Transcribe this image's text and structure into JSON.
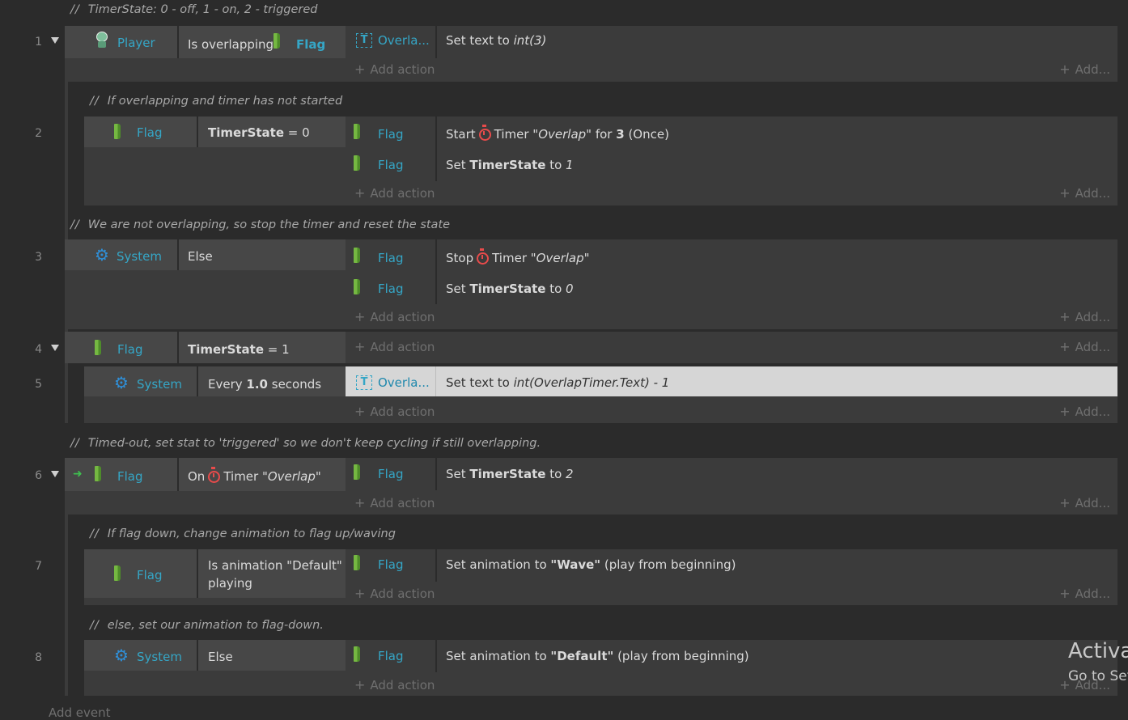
{
  "comments": {
    "c0": "TimerState: 0 - off, 1 - on, 2 - triggered",
    "c2": "If overlapping and timer has not started",
    "c3": "We are not overlapping, so stop the timer and reset the state",
    "c6": "Timed-out, set stat to 'triggered' so we don't keep cycling if still overlapping.",
    "c7": "If flag down, change animation to flag up/waving",
    "c8": "else, set our animation to flag-down."
  },
  "comment_marker": "//",
  "line_numbers": [
    "1",
    "2",
    "3",
    "4",
    "5",
    "6",
    "7",
    "8"
  ],
  "add_action": "Add action",
  "add_right": "Add...",
  "events": {
    "e1": {
      "obj": "Player",
      "cond_text": "Is overlapping",
      "cond_obj": "Flag",
      "a1_obj": "Overla...",
      "a1_text": "Set text to ",
      "a1_italic": "int(3)"
    },
    "e2": {
      "obj": "Flag",
      "cond_var": "TimerState",
      "cond_rest": " = 0",
      "a1_obj": "Flag",
      "a1_pre": "Start",
      "a1_mid": "Timer \"",
      "a1_name": "Overlap",
      "a1_post": "\" for ",
      "a1_num": "3",
      "a1_tail": " (Once)",
      "a2_obj": "Flag",
      "a2_pre": "Set ",
      "a2_var": "TimerState",
      "a2_to": " to ",
      "a2_val": "1"
    },
    "e3": {
      "obj": "System",
      "cond_text": "Else",
      "a1_obj": "Flag",
      "a1_pre": "Stop",
      "a1_mid": "Timer \"",
      "a1_name": "Overlap",
      "a1_post": "\"",
      "a2_obj": "Flag",
      "a2_pre": "Set ",
      "a2_var": "TimerState",
      "a2_to": " to ",
      "a2_val": "0"
    },
    "e4": {
      "obj": "Flag",
      "cond_var": "TimerState",
      "cond_rest": " = 1"
    },
    "e5": {
      "obj": "System",
      "cond_pre": "Every ",
      "cond_num": "1.0",
      "cond_post": " seconds",
      "a1_obj": "Overla...",
      "a1_text": "Set text to ",
      "a1_italic": "int(OverlapTimer.Text) - 1"
    },
    "e6": {
      "obj": "Flag",
      "cond_pre": "On",
      "cond_mid": "Timer \"",
      "cond_name": "Overlap",
      "cond_post": "\"",
      "a1_obj": "Flag",
      "a1_pre": "Set ",
      "a1_var": "TimerState",
      "a1_to": " to ",
      "a1_val": "2"
    },
    "e7": {
      "obj": "Flag",
      "cond_line1": "Is animation \"Default\"",
      "cond_line2": "playing",
      "a1_obj": "Flag",
      "a1_pre": "Set animation to ",
      "a1_bold": "\"Wave\"",
      "a1_post": " (play from beginning)"
    },
    "e8": {
      "obj": "System",
      "cond_text": "Else",
      "a1_obj": "Flag",
      "a1_pre": "Set animation to ",
      "a1_bold": "\"Default\"",
      "a1_post": " (play from beginning)"
    }
  },
  "bottom_add": "Add event",
  "watermark": {
    "line1": "Activat",
    "line2": "Go to Set"
  }
}
